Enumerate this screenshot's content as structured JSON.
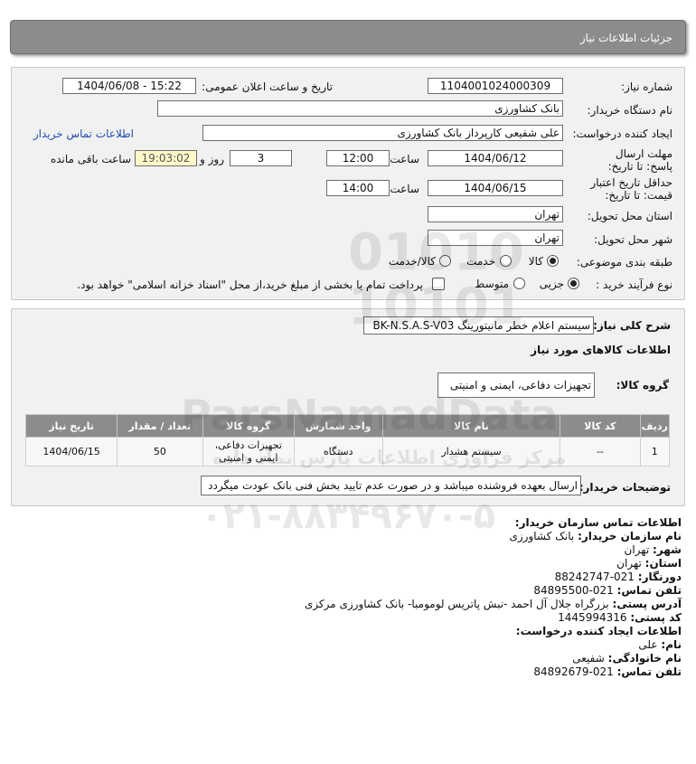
{
  "header": {
    "title": "جزئيات اطلاعات نياز"
  },
  "form": {
    "need_number_label": "شماره نیاز:",
    "need_number": "1104001024000309",
    "announce_label": "تاریخ و ساعت اعلان عمومی:",
    "announce_value": "1404/06/08 - 15:22",
    "buyer_org_label": "نام دستگاه خریدار:",
    "buyer_org": "بانک کشاورزی",
    "creator_label": "ایجاد کننده درخواست:",
    "creator": "علی شفیعی کارپرداز بانک کشاورزی",
    "contact_link": "اطلاعات تماس خریدار",
    "deadline_label": "مهلت ارسال پاسخ: تا تاریخ:",
    "deadline_date": "1404/06/12",
    "time_label": "ساعت",
    "deadline_time": "12:00",
    "days_value": "3",
    "days_label": "روز و",
    "remaining_time": "19:03:02",
    "remaining_label": "ساعت باقی مانده",
    "validity_label": "حداقل تاریخ اعتبار قیمت: تا تاریخ:",
    "validity_date": "1404/06/15",
    "validity_time": "14:00",
    "province_label": "استان محل تحویل:",
    "province": "تهران",
    "city_label": "شهر محل تحویل:",
    "city": "تهران",
    "category_label": "طبقه بندی موضوعی:",
    "category_options": [
      "کالا",
      "خدمت",
      "کالا/خدمت"
    ],
    "process_label": "نوع فرآیند خرید :",
    "process_options": [
      "جزیی",
      "متوسط"
    ],
    "payment_note": "پرداخت تمام یا بخشی از مبلغ خرید،از محل \"اسناد خزانه اسلامی\" خواهد بود."
  },
  "details": {
    "summary_label": "شرح کلی نیاز:",
    "summary": "سیستم اعلام خطر مانیتورینگ BK-N.S.A.S-V03",
    "goods_info_title": "اطلاعات کالاهای مورد نیاز",
    "goods_group_label": "گروه کالا:",
    "goods_group": "تجهیزات دفاعی، ایمنی و امنیتی",
    "table": {
      "headers": [
        "ردیف",
        "کد کالا",
        "نام کالا",
        "واحد شمارش",
        "گروه کالا",
        "تعداد / مقدار",
        "تاریخ نیاز"
      ],
      "rows": [
        [
          "1",
          "--",
          "سیستم هشدار",
          "دستگاه",
          "تجهیزات دفاعی، ایمنی و امنیتی",
          "50",
          "1404/06/15"
        ]
      ]
    },
    "buyer_notes_label": "توضیحات خریدار:",
    "buyer_notes": "ارسال بعهده فروشنده میباشد و در صورت عدم تایید بخش فنی بانک عودت میگردد"
  },
  "contact": {
    "org_title": "اطلاعات تماس سازمان خریدار:",
    "buyer_name_k": "نام سازمان خریدار:",
    "buyer_name_v": "بانک کشاورزی",
    "city_k": "شهر:",
    "city_v": "تهران",
    "province_k": "استان:",
    "province_v": "تهران",
    "fax_k": "دورنگار:",
    "fax_v": "021-88242747",
    "phone_k": "تلفن تماس:",
    "phone_v": "021-84895500",
    "address_k": "آدرس پستی:",
    "address_v": "بزرگراه جلال آل احمد -نبش پاتریس لومومبا- بانک کشاورزی مرکزی",
    "postal_k": "کد پستی:",
    "postal_v": "1445994316",
    "creator_title": "اطلاعات ایجاد کننده درخواست:",
    "first_k": "نام:",
    "first_v": "علی",
    "last_k": "نام خانوادگی:",
    "last_v": "شفیعی",
    "cphone_k": "تلفن تماس:",
    "cphone_v": "021-84892679"
  },
  "watermark": {
    "brand": "ParsNamadData",
    "tagline": "مرکز فراوری اطلاعات پارس نماد داده",
    "number": "۰۲۱-۸۸۳۴۹۶۷۰-۵"
  }
}
